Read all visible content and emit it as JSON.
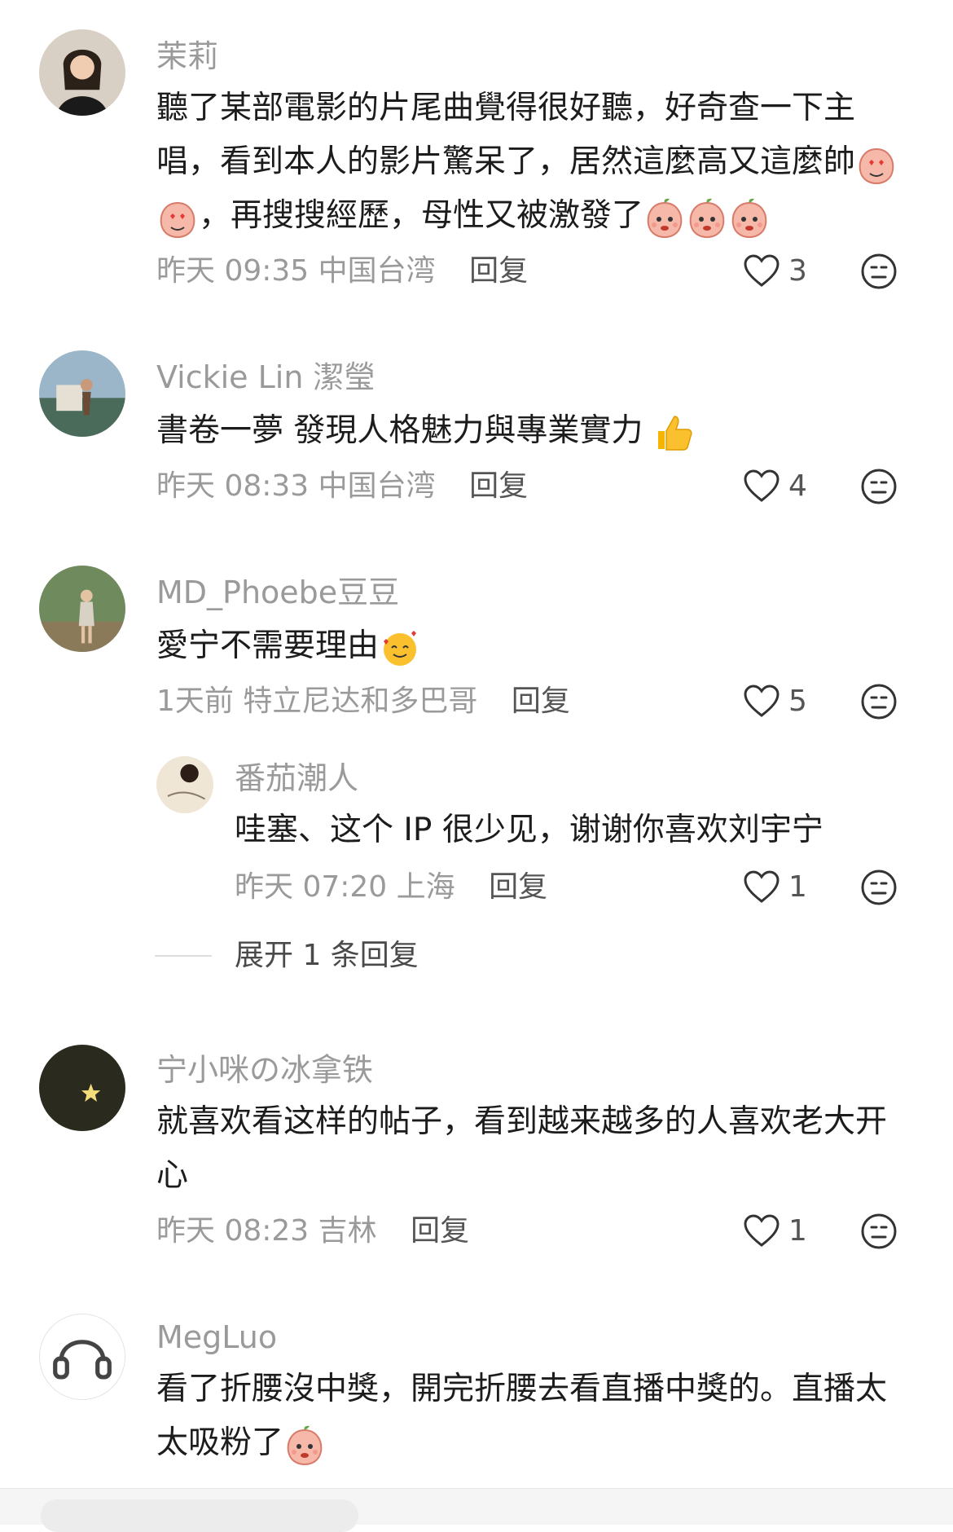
{
  "comments": [
    {
      "username": "茉莉",
      "text_part1": "聽了某部電影的片尾曲覺得很好聽，好奇查一下主唱，看到本人的影片驚呆了，居然這麼高又這麼帥",
      "text_part2": "，再搜搜經歷，母性又被激發了",
      "time": "昨天 09:35",
      "location": "中国台湾",
      "reply_label": "回复",
      "likes": "3"
    },
    {
      "username": "Vickie Lin 潔瑩",
      "text": "書卷一夢 發現人格魅力與專業實力",
      "time": "昨天 08:33",
      "location": "中国台湾",
      "reply_label": "回复",
      "likes": "4"
    },
    {
      "username": "MD_Phoebe豆豆",
      "text": "愛宁不需要理由",
      "time": "1天前",
      "location": "特立尼达和多巴哥",
      "reply_label": "回复",
      "likes": "5"
    },
    {
      "username": "番茄潮人",
      "text": "哇塞、这个 IP 很少见，谢谢你喜欢刘宇宁",
      "time": "昨天 07:20",
      "location": "上海",
      "reply_label": "回复",
      "likes": "1"
    },
    {
      "username": "宁小咪の冰拿铁",
      "text": "就喜欢看这样的帖子，看到越来越多的人喜欢老大开心",
      "time": "昨天 08:23",
      "location": "吉林",
      "reply_label": "回复",
      "likes": "1"
    },
    {
      "username": "MegLuo",
      "text": "看了折腰沒中獎，開完折腰去看直播中獎的。直播太太吸粉了"
    }
  ],
  "expand_replies": "展开 1 条回复",
  "icons": {
    "like": "heart-outline-icon",
    "dislike": "neutral-face-icon",
    "reaction": "peach-emoji-icon"
  },
  "colors": {
    "username": "#9a9a9a",
    "text": "#1c1c1c",
    "meta": "#9a9a9a"
  }
}
